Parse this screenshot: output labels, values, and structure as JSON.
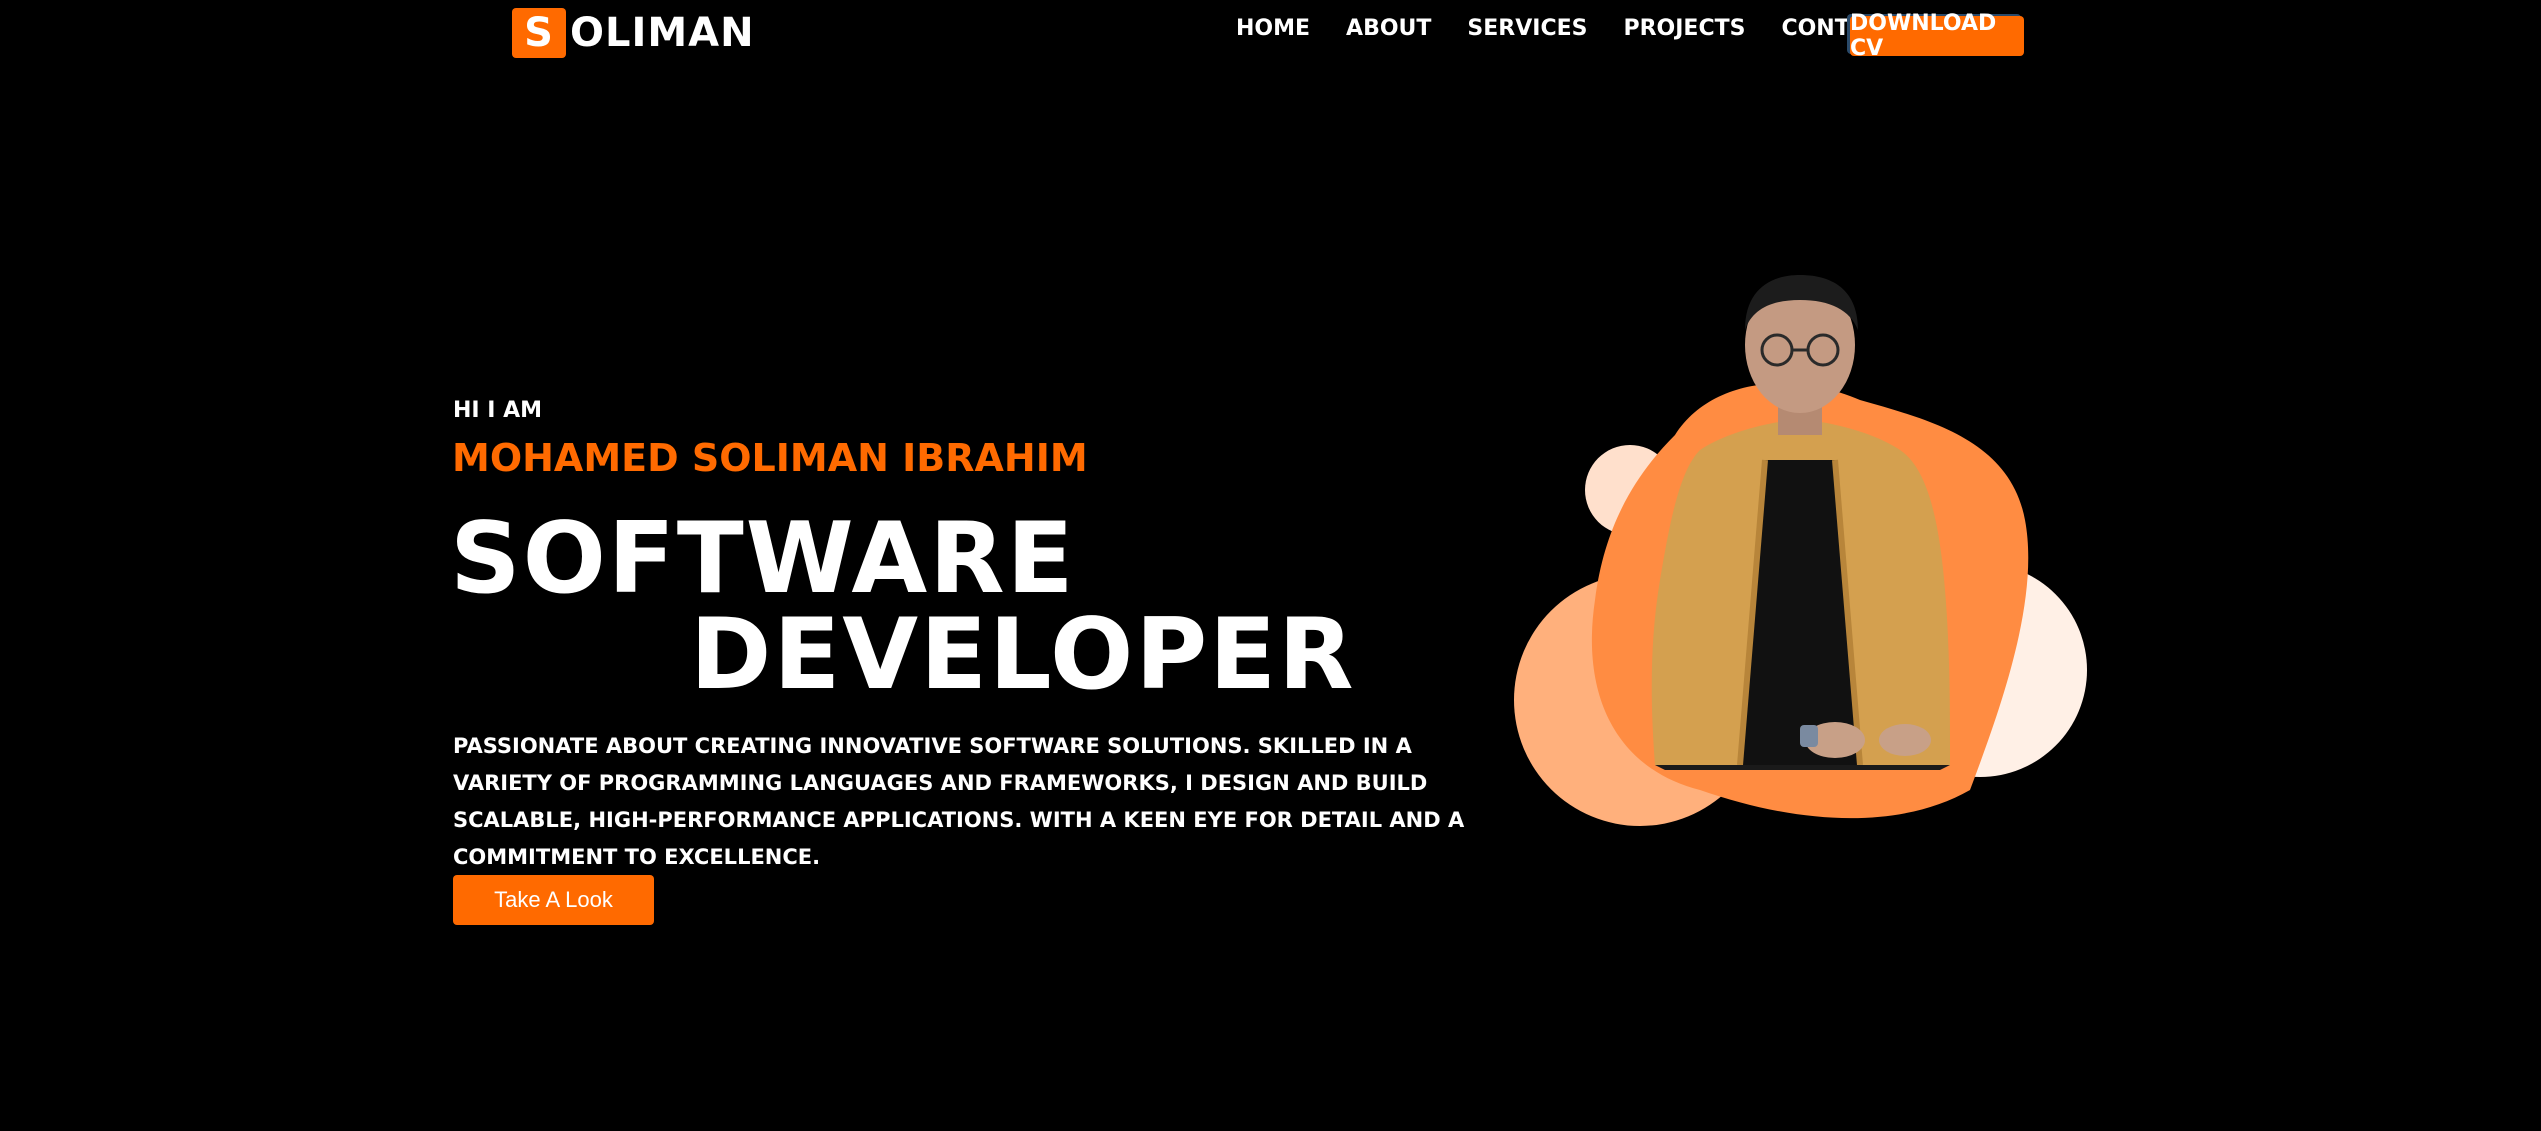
{
  "header": {
    "logo_letter": "S",
    "logo_rest": "OLIMAN",
    "nav": [
      {
        "label": "HOME"
      },
      {
        "label": "ABOUT"
      },
      {
        "label": "SERVICES"
      },
      {
        "label": "PROJECTS"
      },
      {
        "label": "CONTACT US"
      }
    ],
    "cv_button": "DOWNLOAD CV"
  },
  "hero": {
    "greeting": "HI I AM",
    "name": "MOHAMED SOLIMAN IBRAHIM",
    "title_line1": "SOFTWARE",
    "title_line2": "DEVELOPER",
    "description": "PASSIONATE ABOUT CREATING INNOVATIVE SOFTWARE SOLUTIONS. SKILLED IN A VARIETY OF PROGRAMMING LANGUAGES AND FRAMEWORKS, I DESIGN AND BUILD SCALABLE, HIGH-PERFORMANCE APPLICATIONS. WITH A KEEN EYE FOR DETAIL AND A COMMITMENT TO EXCELLENCE.",
    "cta": "Take A Look"
  },
  "colors": {
    "accent": "#ff6a00",
    "blob_main": "#ff8c42",
    "blob_light": "#ffb07c",
    "blob_pale": "#fff0e6",
    "background": "#000000"
  }
}
